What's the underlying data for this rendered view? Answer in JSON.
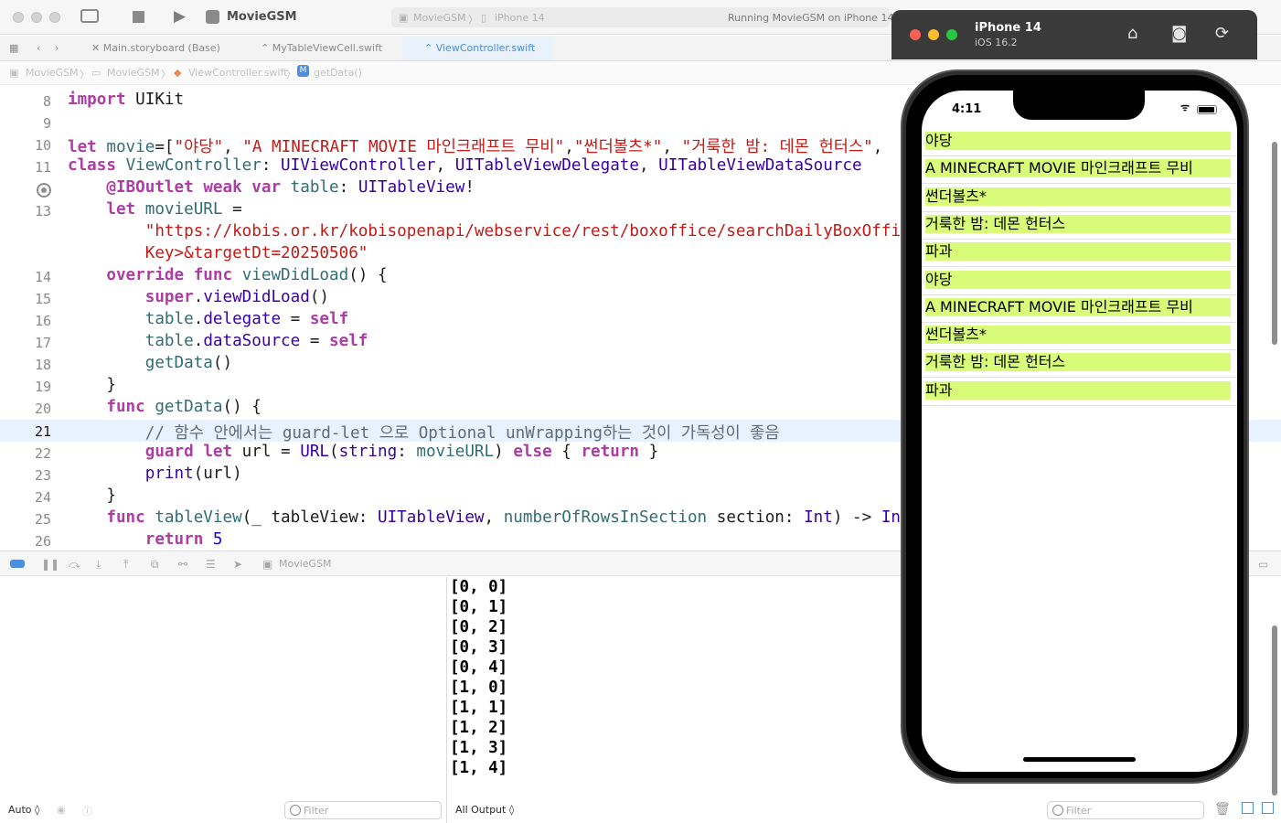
{
  "toolbar": {
    "project_name": "MovieGSM",
    "scheme": "MovieGSM",
    "destination": "iPhone 14",
    "status": "Running MovieGSM on iPhone 14"
  },
  "tabs": [
    {
      "label": "Main.storyboard (Base)"
    },
    {
      "label": "MyTableViewCell.swift"
    },
    {
      "label": "ViewController.swift"
    }
  ],
  "jumpbar": {
    "items": [
      "MovieGSM",
      "MovieGSM",
      "ViewController.swift",
      "getData()"
    ]
  },
  "editor": {
    "current_line": "21",
    "lines": [
      {
        "num": "8",
        "segs": [
          [
            "k",
            "import"
          ],
          [
            "p",
            " UIKit"
          ]
        ]
      },
      {
        "num": "9",
        "segs": []
      },
      {
        "num": "10",
        "segs": [
          [
            "k",
            "let"
          ],
          [
            "p",
            " "
          ],
          [
            "f",
            "movie"
          ],
          [
            "p",
            "=["
          ],
          [
            "s",
            "\"야당\""
          ],
          [
            "p",
            ", "
          ],
          [
            "s",
            "\"A MINECRAFT MOVIE 마인크래프트 무비\""
          ],
          [
            "p",
            ","
          ],
          [
            "s",
            "\"썬더볼츠*\""
          ],
          [
            "p",
            ", "
          ],
          [
            "s",
            "\"거룩한 밤: 데몬 헌터스\""
          ],
          [
            "p",
            ","
          ]
        ]
      },
      {
        "num": "11",
        "segs": [
          [
            "k",
            "class"
          ],
          [
            "p",
            " "
          ],
          [
            "f",
            "ViewController"
          ],
          [
            "p",
            ": "
          ],
          [
            "t",
            "UIViewController"
          ],
          [
            "p",
            ", "
          ],
          [
            "t",
            "UITableViewDelegate"
          ],
          [
            "p",
            ", "
          ],
          [
            "t",
            "UITableViewDataSource"
          ]
        ]
      },
      {
        "num": "",
        "segs": [
          [
            "p",
            "    "
          ],
          [
            "k",
            "@IBOutlet"
          ],
          [
            "p",
            " "
          ],
          [
            "k",
            "weak"
          ],
          [
            "p",
            " "
          ],
          [
            "k",
            "var"
          ],
          [
            "p",
            " "
          ],
          [
            "f",
            "table"
          ],
          [
            "p",
            ": "
          ],
          [
            "t",
            "UITableView"
          ],
          [
            "p",
            "!"
          ]
        ]
      },
      {
        "num": "13",
        "segs": [
          [
            "p",
            "    "
          ],
          [
            "k",
            "let"
          ],
          [
            "p",
            " "
          ],
          [
            "f",
            "movieURL"
          ],
          [
            "p",
            " ="
          ]
        ]
      },
      {
        "num": "",
        "segs": [
          [
            "p",
            "        "
          ],
          [
            "s",
            "\"https://kobis.or.kr/kobisopenapi/webservice/rest/boxoffice/searchDailyBoxOfficeList.json?key=<API"
          ]
        ]
      },
      {
        "num": "",
        "segs": [
          [
            "p",
            "        "
          ],
          [
            "s",
            "Key>&targetDt=20250506\""
          ]
        ]
      },
      {
        "num": "14",
        "segs": [
          [
            "p",
            "    "
          ],
          [
            "k",
            "override"
          ],
          [
            "p",
            " "
          ],
          [
            "k",
            "func"
          ],
          [
            "p",
            " "
          ],
          [
            "f",
            "viewDidLoad"
          ],
          [
            "p",
            "() {"
          ]
        ]
      },
      {
        "num": "15",
        "segs": [
          [
            "p",
            "        "
          ],
          [
            "k",
            "super"
          ],
          [
            "p",
            "."
          ],
          [
            "t",
            "viewDidLoad"
          ],
          [
            "p",
            "()"
          ]
        ]
      },
      {
        "num": "16",
        "segs": [
          [
            "p",
            "        "
          ],
          [
            "f",
            "table"
          ],
          [
            "p",
            "."
          ],
          [
            "t",
            "delegate"
          ],
          [
            "p",
            " = "
          ],
          [
            "k",
            "self"
          ]
        ]
      },
      {
        "num": "17",
        "segs": [
          [
            "p",
            "        "
          ],
          [
            "f",
            "table"
          ],
          [
            "p",
            "."
          ],
          [
            "t",
            "dataSource"
          ],
          [
            "p",
            " = "
          ],
          [
            "k",
            "self"
          ]
        ]
      },
      {
        "num": "18",
        "segs": [
          [
            "p",
            "        "
          ],
          [
            "f",
            "getData"
          ],
          [
            "p",
            "()"
          ]
        ]
      },
      {
        "num": "19",
        "segs": [
          [
            "p",
            "    }"
          ]
        ]
      },
      {
        "num": "20",
        "segs": [
          [
            "p",
            "    "
          ],
          [
            "k",
            "func"
          ],
          [
            "p",
            " "
          ],
          [
            "f",
            "getData"
          ],
          [
            "p",
            "() {"
          ]
        ]
      },
      {
        "num": "21",
        "segs": [
          [
            "p",
            "        "
          ],
          [
            "c",
            "// 함수 안에서는 guard-let 으로 Optional unWrapping하는 것이 가독성이 좋음"
          ]
        ]
      },
      {
        "num": "22",
        "segs": [
          [
            "p",
            "        "
          ],
          [
            "k",
            "guard"
          ],
          [
            "p",
            " "
          ],
          [
            "k",
            "let"
          ],
          [
            "p",
            " url = "
          ],
          [
            "t",
            "URL"
          ],
          [
            "p",
            "("
          ],
          [
            "t",
            "string"
          ],
          [
            "p",
            ": "
          ],
          [
            "f",
            "movieURL"
          ],
          [
            "p",
            ") "
          ],
          [
            "k",
            "else"
          ],
          [
            "p",
            " { "
          ],
          [
            "k",
            "return"
          ],
          [
            "p",
            " }"
          ]
        ]
      },
      {
        "num": "23",
        "segs": [
          [
            "p",
            "        "
          ],
          [
            "t",
            "print"
          ],
          [
            "p",
            "(url)"
          ]
        ]
      },
      {
        "num": "24",
        "segs": [
          [
            "p",
            "    }"
          ]
        ]
      },
      {
        "num": "25",
        "segs": [
          [
            "p",
            "    "
          ],
          [
            "k",
            "func"
          ],
          [
            "p",
            " "
          ],
          [
            "f",
            "tableView"
          ],
          [
            "p",
            "(_ tableView: "
          ],
          [
            "t",
            "UITableView"
          ],
          [
            "p",
            ", "
          ],
          [
            "f",
            "numberOfRowsInSection"
          ],
          [
            "p",
            " section: "
          ],
          [
            "t",
            "Int"
          ],
          [
            "p",
            ") -> "
          ],
          [
            "t",
            "Int"
          ],
          [
            "p",
            " {"
          ]
        ]
      },
      {
        "num": "26",
        "segs": [
          [
            "p",
            "        "
          ],
          [
            "k",
            "return"
          ],
          [
            "p",
            " "
          ],
          [
            "n",
            "5"
          ]
        ]
      }
    ]
  },
  "debugbar": {
    "target": "MovieGSM"
  },
  "variables": {
    "scope": "Auto ◊",
    "filter_placeholder": "Filter"
  },
  "console": {
    "output": [
      "[0, 0]",
      "[0, 1]",
      "[0, 2]",
      "[0, 3]",
      "[0, 4]",
      "[1, 0]",
      "[1, 1]",
      "[1, 2]",
      "[1, 3]",
      "[1, 4]"
    ],
    "mode": "All Output ◊",
    "filter_placeholder": "Filter"
  },
  "simulator": {
    "device": "iPhone 14",
    "os": "iOS 16.2",
    "time": "4:11",
    "cell_color": "#d9fb7a",
    "rows": [
      "야당",
      "A MINECRAFT MOVIE 마인크래프트 무비",
      "썬더볼츠*",
      "거룩한 밤: 데몬 헌터스",
      "파과",
      "야당",
      "A MINECRAFT MOVIE 마인크래프트 무비",
      "썬더볼츠*",
      "거룩한 밤: 데몬 헌터스",
      "파과"
    ]
  }
}
